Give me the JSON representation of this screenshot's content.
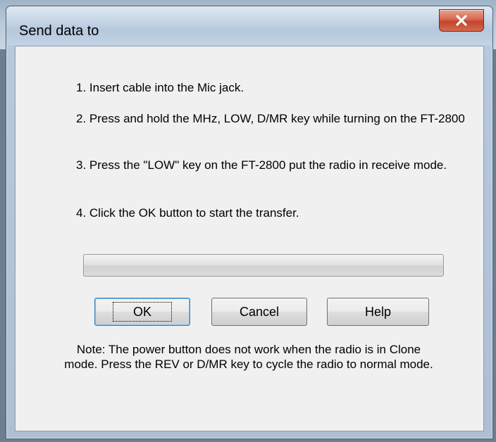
{
  "dialog": {
    "title": "Send data to",
    "close_label": "close"
  },
  "instructions": [
    "1. Insert cable into the Mic jack.",
    "2. Press and hold the MHz, LOW, D/MR key while turning on the FT-2800",
    "3. Press the \"LOW\" key on the FT-2800 put the radio in receive mode.",
    "4. Click the OK button to start the transfer."
  ],
  "progress": {
    "value_percent": 0
  },
  "buttons": {
    "ok": "OK",
    "cancel": "Cancel",
    "help": "Help"
  },
  "note": "Note: The power button does not work when the radio is in Clone mode.  Press the REV or D/MR key to cycle the radio to normal mode.",
  "colors": {
    "close_button": "#c2432a",
    "focus_border": "#3c7fb1"
  }
}
